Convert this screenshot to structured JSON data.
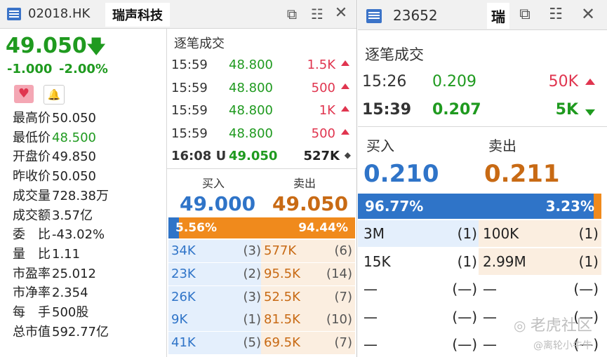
{
  "left_window": {
    "tab_code": "02018.HK",
    "tab_name": "瑞声科技",
    "price": "49.050",
    "change": "-1.000",
    "change_pct": "-2.00%",
    "stats": [
      {
        "label": "最高价",
        "value": "50.050"
      },
      {
        "label": "最低价",
        "value": "48.500"
      },
      {
        "label": "开盘价",
        "value": "49.850"
      },
      {
        "label": "昨收价",
        "value": "50.050"
      },
      {
        "label": "成交量",
        "value": "728.38万"
      },
      {
        "label": "成交额",
        "value": "3.57亿"
      },
      {
        "label": "委　比",
        "value": "-43.02%"
      },
      {
        "label": "量　比",
        "value": "1.11"
      },
      {
        "label": "市盈率",
        "value": "25.012"
      },
      {
        "label": "市净率",
        "value": "2.354"
      },
      {
        "label": "每　手",
        "value": "500股"
      },
      {
        "label": "总市值",
        "value": "592.77亿"
      }
    ],
    "trades_title": "逐笔成交",
    "trades": [
      {
        "time": "15:59",
        "price": "48.800",
        "volume": "1.5K"
      },
      {
        "time": "15:59",
        "price": "48.800",
        "volume": "500"
      },
      {
        "time": "15:59",
        "price": "48.800",
        "volume": "1K"
      },
      {
        "time": "15:59",
        "price": "48.800",
        "volume": "500"
      }
    ],
    "last_trade": {
      "time": "16:08 U",
      "price": "49.050",
      "volume": "527K",
      "marker": "◆"
    },
    "bid_label": "买入",
    "ask_label": "卖出",
    "bid_price": "49.000",
    "ask_price": "49.050",
    "bid_pct": "5.56%",
    "ask_pct": "94.44%",
    "bid_ratio": 0.0556,
    "depth": [
      {
        "bid_vol": "34K",
        "bid_n": "(3)",
        "ask_vol": "577K",
        "ask_n": "(6)"
      },
      {
        "bid_vol": "23K",
        "bid_n": "(2)",
        "ask_vol": "95.5K",
        "ask_n": "(14)"
      },
      {
        "bid_vol": "26K",
        "bid_n": "(3)",
        "ask_vol": "52.5K",
        "ask_n": "(7)"
      },
      {
        "bid_vol": "9K",
        "bid_n": "(1)",
        "ask_vol": "81.5K",
        "ask_n": "(10)"
      },
      {
        "bid_vol": "41K",
        "bid_n": "(5)",
        "ask_vol": "69.5K",
        "ask_n": "(7)"
      }
    ]
  },
  "right_window": {
    "tab_code": "23652",
    "tab_name": "瑞",
    "trades_title": "逐笔成交",
    "trades": [
      {
        "time": "15:26",
        "price": "0.209",
        "volume": "50K",
        "dir": "up"
      },
      {
        "time": "15:39",
        "price": "0.207",
        "volume": "5K",
        "dir": "down"
      }
    ],
    "bid_label": "买入",
    "ask_label": "卖出",
    "bid_price": "0.210",
    "ask_price": "0.211",
    "bid_pct": "96.77%",
    "ask_pct": "3.23%",
    "bid_ratio": 0.9677,
    "depth": [
      {
        "bid_vol": "3M",
        "bid_n": "(1)",
        "ask_vol": "100K",
        "ask_n": "(1)"
      },
      {
        "bid_vol": "15K",
        "bid_n": "(1)",
        "ask_vol": "2.99M",
        "ask_n": "(1)"
      },
      {
        "bid_vol": "—",
        "bid_n": "(—)",
        "ask_vol": "—",
        "ask_n": "(—)"
      },
      {
        "bid_vol": "—",
        "bid_n": "(—)",
        "ask_vol": "—",
        "ask_n": "(—)"
      },
      {
        "bid_vol": "—",
        "bid_n": "(—)",
        "ask_vol": "—",
        "ask_n": "(—)"
      }
    ]
  },
  "watermark": {
    "brand": "老虎社区",
    "user": "@离轮小牛牛"
  },
  "colors": {
    "up": "#e0354f",
    "down": "#1f9a1f",
    "bid": "#2f74c8",
    "ask": "#c86a14",
    "bid_bar": "#2f74c8",
    "ask_bar": "#f08a1c"
  },
  "icons": [
    "app-icon",
    "popout-icon",
    "settings-icon",
    "close-icon",
    "heart-icon",
    "bell-icon",
    "arrow-down-icon",
    "triangle-up-icon",
    "triangle-down-icon"
  ]
}
